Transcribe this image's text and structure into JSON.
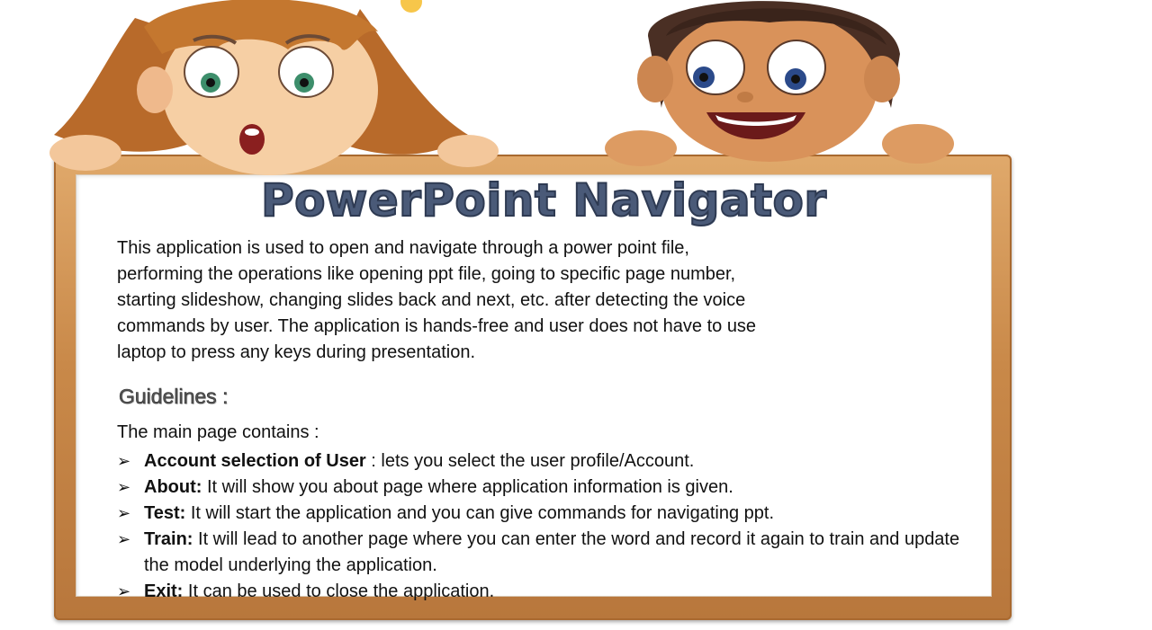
{
  "slide": {
    "title": "PowerPoint Navigator",
    "intro_lines": [
      "This application is used to open and navigate through a power point file,",
      "performing the operations like opening ppt file, going to specific page number,",
      "starting slideshow, changing slides back and next, etc. after detecting the voice",
      "commands by user. The application is hands-free and user does not have to use",
      "laptop to press any keys during presentation."
    ],
    "guidelines_heading": "Guidelines :",
    "main_page_label": "The main page contains :",
    "bullet_glyph": "➢",
    "items": [
      {
        "term": "Account selection of User",
        "text": " : lets you select the user profile/Account."
      },
      {
        "term": "About:",
        "text": " It will show you about page where application information is given."
      },
      {
        "term": "Test:",
        "text": " It will start the application and you can give commands for navigating ppt."
      },
      {
        "term": "Train:",
        "text": " It will lead to another page where you can enter the word and record it again to train and update the model underlying the application."
      },
      {
        "term": "Exit:",
        "text": " It can be used to close the application."
      }
    ]
  },
  "decor": {
    "icons": [
      "girl-cartoon-icon",
      "boy-cartoon-icon",
      "wooden-board-icon"
    ],
    "colors": {
      "frame": "#c98949",
      "title": "#4a5a78",
      "text": "#111111"
    }
  }
}
